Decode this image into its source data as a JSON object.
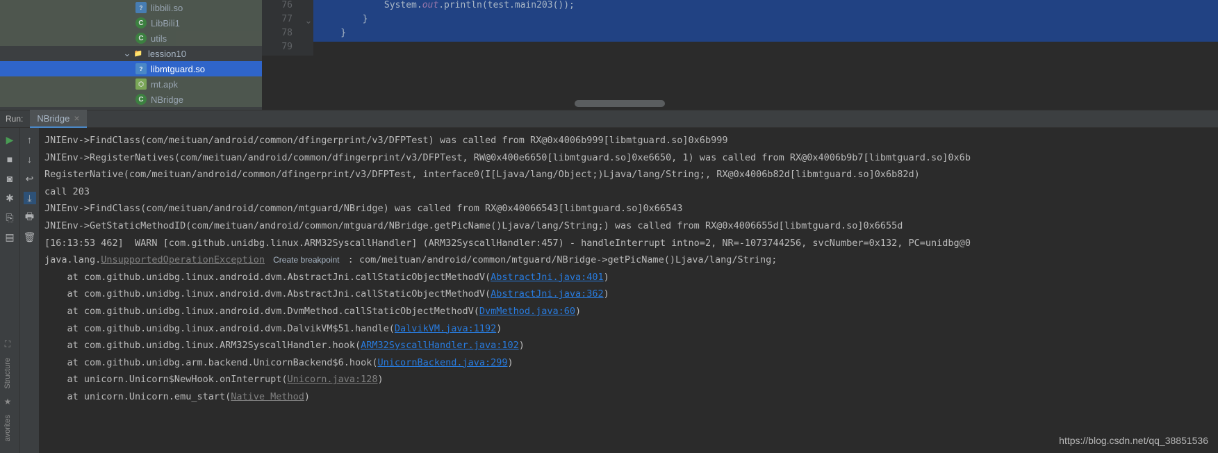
{
  "tree": {
    "items": [
      {
        "label": "libbili.so",
        "icon": "so",
        "indent": 2,
        "cls": "cut"
      },
      {
        "label": "LibBili1",
        "icon": "class",
        "indent": 2,
        "cls": "cut"
      },
      {
        "label": "utils",
        "icon": "class",
        "indent": 2,
        "cls": "cut"
      },
      {
        "label": "lession10",
        "icon": "folder",
        "indent": 1,
        "chevron": "down",
        "cls": ""
      },
      {
        "label": "libmtguard.so",
        "icon": "so",
        "indent": 2,
        "cls": "selected"
      },
      {
        "label": "mt.apk",
        "icon": "apk",
        "indent": 2,
        "cls": "cut"
      },
      {
        "label": "NBridge",
        "icon": "class",
        "indent": 2,
        "cls": "cut"
      }
    ]
  },
  "editor": {
    "lines": [
      {
        "num": 76,
        "selected": true,
        "html": "            System.<span class='kw-static'>out</span>.println(test.main203());"
      },
      {
        "num": 77,
        "selected": true,
        "html": "        }",
        "marker": "⌄"
      },
      {
        "num": 78,
        "selected": true,
        "html": "    }"
      },
      {
        "num": 79,
        "selected": false,
        "html": ""
      }
    ]
  },
  "run": {
    "label": "Run:",
    "tab_label": "NBridge",
    "create_breakpoint": "Create breakpoint"
  },
  "console": {
    "lines": [
      {
        "type": "plain",
        "text": "JNIEnv->FindClass(com/meituan/android/common/dfingerprint/v3/DFPTest) was called from RX@0x4006b999[libmtguard.so]0x6b999"
      },
      {
        "type": "plain",
        "text": "JNIEnv->RegisterNatives(com/meituan/android/common/dfingerprint/v3/DFPTest, RW@0x400e6650[libmtguard.so]0xe6650, 1) was called from RX@0x4006b9b7[libmtguard.so]0x6b"
      },
      {
        "type": "plain",
        "text": "RegisterNative(com/meituan/android/common/dfingerprint/v3/DFPTest, interface0(I[Ljava/lang/Object;)Ljava/lang/String;, RX@0x4006b82d[libmtguard.so]0x6b82d)"
      },
      {
        "type": "plain",
        "text": "call 203"
      },
      {
        "type": "plain",
        "text": "JNIEnv->FindClass(com/meituan/android/common/mtguard/NBridge) was called from RX@0x40066543[libmtguard.so]0x66543"
      },
      {
        "type": "plain",
        "text": "JNIEnv->GetStaticMethodID(com/meituan/android/common/mtguard/NBridge.getPicName()Ljava/lang/String;) was called from RX@0x4006655d[libmtguard.so]0x6655d"
      },
      {
        "type": "plain",
        "text": "[16:13:53 462]  WARN [com.github.unidbg.linux.ARM32SyscallHandler] (ARM32SyscallHandler:457) - handleInterrupt intno=2, NR=-1073744256, svcNumber=0x132, PC=unidbg@0"
      },
      {
        "type": "exc",
        "prefix": "java.lang.",
        "link": "UnsupportedOperationException",
        "suffix": " : com/meituan/android/common/mtguard/NBridge->getPicName()Ljava/lang/String;"
      },
      {
        "type": "frame",
        "prefix": "    at com.github.unidbg.linux.android.dvm.AbstractJni.callStaticObjectMethodV(",
        "link": "AbstractJni.java:401",
        "suffix": ")"
      },
      {
        "type": "frame",
        "prefix": "    at com.github.unidbg.linux.android.dvm.AbstractJni.callStaticObjectMethodV(",
        "link": "AbstractJni.java:362",
        "suffix": ")"
      },
      {
        "type": "frame",
        "prefix": "    at com.github.unidbg.linux.android.dvm.DvmMethod.callStaticObjectMethodV(",
        "link": "DvmMethod.java:60",
        "suffix": ")"
      },
      {
        "type": "frame",
        "prefix": "    at com.github.unidbg.linux.android.dvm.DalvikVM$51.handle(",
        "link": "DalvikVM.java:1192",
        "suffix": ")"
      },
      {
        "type": "frame",
        "prefix": "    at com.github.unidbg.linux.ARM32SyscallHandler.hook(",
        "link": "ARM32SyscallHandler.java:102",
        "suffix": ")"
      },
      {
        "type": "frame",
        "prefix": "    at com.github.unidbg.arm.backend.UnicornBackend$6.hook(",
        "link": "UnicornBackend.java:299",
        "suffix": ")"
      },
      {
        "type": "mframe",
        "prefix": "    at unicorn.Unicorn$NewHook.onInterrupt(",
        "link": "Unicorn.java:128",
        "suffix": ")"
      },
      {
        "type": "mframe",
        "prefix": "    at unicorn.Unicorn.emu_start(",
        "link": "Native Method",
        "suffix": ")"
      }
    ]
  },
  "sidebar": {
    "structure": "Structure",
    "favorites": "avorites"
  },
  "watermark": "https://blog.csdn.net/qq_38851536"
}
